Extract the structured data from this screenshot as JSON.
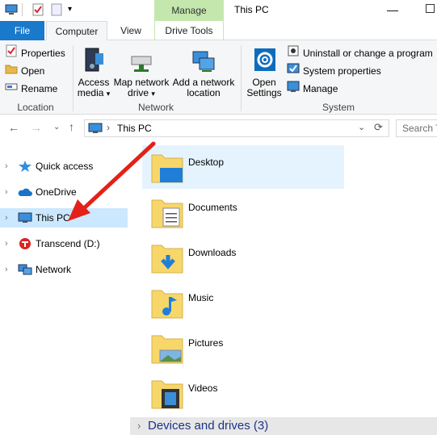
{
  "window": {
    "title": "This PC"
  },
  "context_tab": {
    "label": "Manage"
  },
  "tabs": [
    "File",
    "Computer",
    "View",
    "Drive Tools"
  ],
  "ribbon": {
    "location": {
      "label": "Location",
      "items": [
        "Properties",
        "Open",
        "Rename"
      ]
    },
    "network": {
      "label": "Network",
      "access_media": [
        "Access",
        "media"
      ],
      "map_drive": [
        "Map network",
        "drive"
      ],
      "add_location": [
        "Add a network",
        "location"
      ]
    },
    "system": {
      "label": "System",
      "open_settings": [
        "Open",
        "Settings"
      ],
      "items": [
        "Uninstall or change a program",
        "System properties",
        "Manage"
      ]
    }
  },
  "address": {
    "path": "This PC",
    "search_placeholder": "Search T"
  },
  "nav": {
    "items": [
      "Quick access",
      "OneDrive",
      "This PC",
      "Transcend (D:)",
      "Network"
    ],
    "selected": "This PC"
  },
  "folders": [
    "Desktop",
    "Documents",
    "Downloads",
    "Music",
    "Pictures",
    "Videos"
  ],
  "devices_header": "Devices and drives (3)",
  "colors": {
    "accent": "#1979ca",
    "selection": "#cce8ff",
    "manage_tab": "#c4e7ae",
    "arrow": "#e32119"
  }
}
